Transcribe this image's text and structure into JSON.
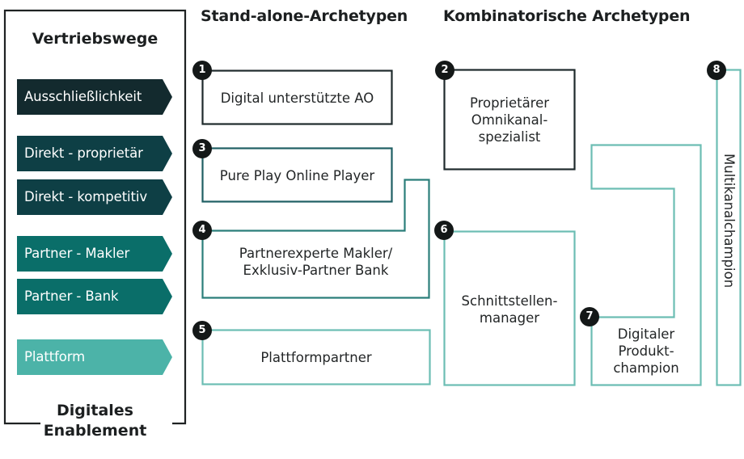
{
  "colors": {
    "dark": "#132a2e",
    "dark_teal": "#0e3f45",
    "teal": "#0a6e69",
    "light_teal": "#4cb3a8",
    "box_border_dark": "#1e2a2c",
    "box_border_teal_dark": "#1f5f63",
    "box_border_teal": "#2b7e7a",
    "box_border_light": "#6cbdb3"
  },
  "left_panel": {
    "title": "Vertriebswege",
    "footer_line1": "Digitales",
    "footer_line2": "Enablement",
    "channels": [
      {
        "label": "Ausschließlichkeit",
        "tone": "dark"
      },
      {
        "label": "Direkt - proprietär",
        "tone": "dark_teal"
      },
      {
        "label": "Direkt - kompetitiv",
        "tone": "dark_teal"
      },
      {
        "label": "Partner - Makler",
        "tone": "teal"
      },
      {
        "label": "Partner - Bank",
        "tone": "teal"
      },
      {
        "label": "Plattform",
        "tone": "light_teal"
      }
    ]
  },
  "headings": {
    "standalone": "Stand-alone-Archetypen",
    "combinatorial": "Kombinatorische Archetypen"
  },
  "archetypes": [
    {
      "number": "1",
      "label_lines": [
        "Digital unterstützte AO"
      ]
    },
    {
      "number": "2",
      "label_lines": [
        "Proprietärer",
        "Omnikanal-",
        "spezialist"
      ]
    },
    {
      "number": "3",
      "label_lines": [
        "Pure Play Online Player"
      ]
    },
    {
      "number": "4",
      "label_lines": [
        "Partnerexperte Makler/",
        "Exklusiv-Partner Bank"
      ]
    },
    {
      "number": "5",
      "label_lines": [
        "Plattformpartner"
      ]
    },
    {
      "number": "6",
      "label_lines": [
        "Schnittstellen-",
        "manager"
      ]
    },
    {
      "number": "7",
      "label_lines": [
        "Digitaler",
        "Produkt-",
        "champion"
      ]
    },
    {
      "number": "8",
      "label_lines": [
        "Multikanalchampion"
      ]
    }
  ]
}
